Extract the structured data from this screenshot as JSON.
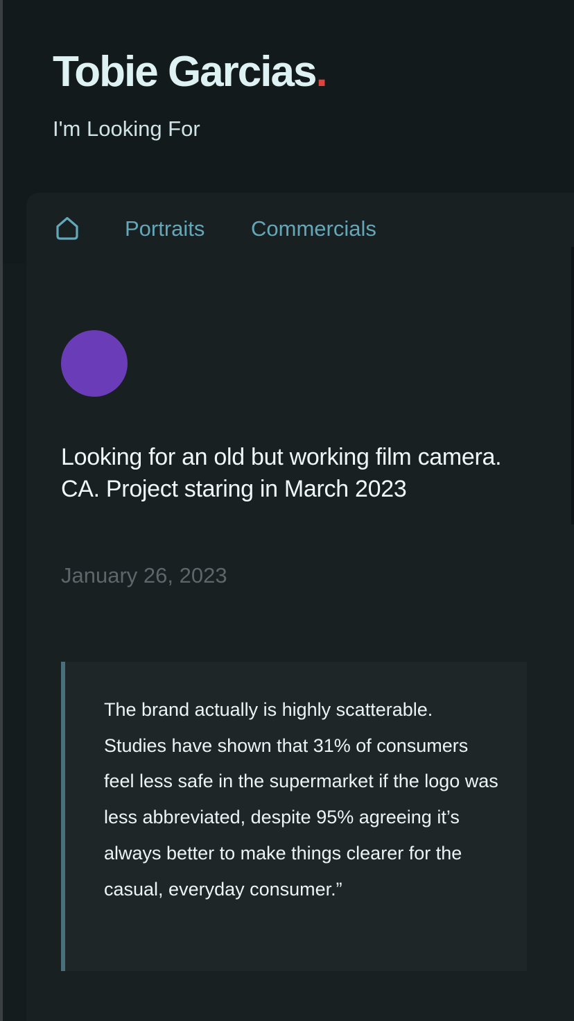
{
  "header": {
    "title": "Tobie Garcias",
    "title_dot": ".",
    "subtitle": "I'm Looking For"
  },
  "nav": {
    "home_icon": "home-icon",
    "items": [
      {
        "label": "Portraits"
      },
      {
        "label": "Commercials"
      }
    ]
  },
  "post": {
    "avatar_color": "#6a3cb8",
    "title": "Looking for an old but working film camera. CA. Project staring in March 2023",
    "date": "January 26, 2023",
    "quote": "The brand actually is highly scatterable. Studies have shown that 31% of consumers feel less safe in the supermarket if the logo was less abbreviated, despite 95% agreeing it’s always better to make things clearer for the casual, everyday consumer.”"
  },
  "colors": {
    "accent_dot": "#e0433b",
    "nav_link": "#63a7b8",
    "quote_border": "#4b6f7a"
  }
}
